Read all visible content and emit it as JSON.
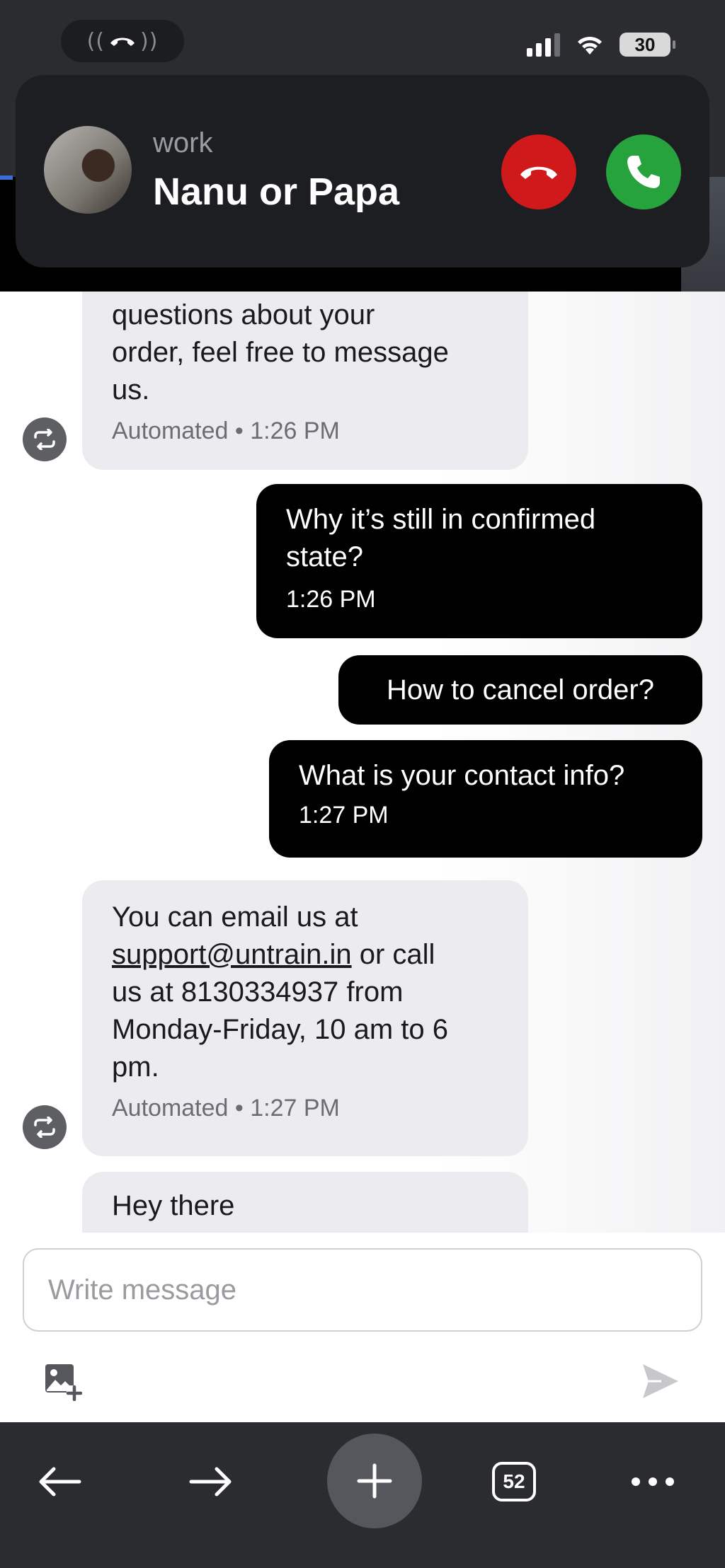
{
  "status_bar": {
    "battery_level": "30",
    "signal_bars": 3,
    "wifi": true
  },
  "call_banner": {
    "label": "work",
    "caller_name": "Nanu or Papa",
    "decline_color": "#d0191b",
    "accept_color": "#27a33d"
  },
  "chat": {
    "messages": [
      {
        "direction": "incoming",
        "text": "questions about your order, feel free to message us.",
        "meta": "Automated • 1:26 PM"
      },
      {
        "direction": "outgoing",
        "text": "Why it’s still in confirmed state?",
        "meta": "1:26 PM"
      },
      {
        "direction": "outgoing",
        "text": "How to cancel order?",
        "meta": ""
      },
      {
        "direction": "outgoing",
        "text": "What is your contact info?",
        "meta": "1:27 PM"
      },
      {
        "direction": "incoming",
        "text_before": "You can email us at ",
        "link": "support@untrain.in",
        "text_after": " or call us at 8130334937 from Monday-Friday, 10 am to 6 pm.",
        "meta": "Automated • 1:27 PM"
      },
      {
        "direction": "incoming",
        "text": "Hey there",
        "meta": ""
      }
    ]
  },
  "composer": {
    "placeholder": "Write message"
  },
  "toolbar": {
    "tab_count": "52"
  }
}
